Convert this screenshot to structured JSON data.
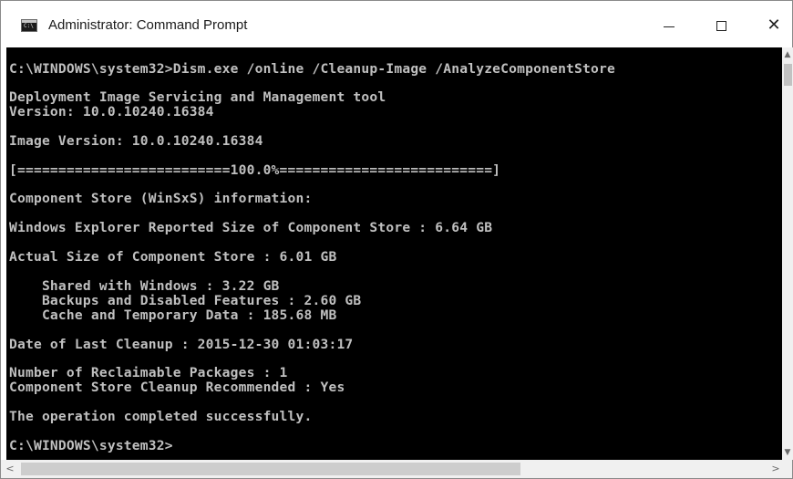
{
  "window": {
    "title": "Administrator: Command Prompt",
    "controls": {
      "minimize": "—",
      "maximize": "",
      "close": "✕"
    }
  },
  "console": {
    "lines": [
      "C:\\WINDOWS\\system32>Dism.exe /online /Cleanup-Image /AnalyzeComponentStore",
      "",
      "Deployment Image Servicing and Management tool",
      "Version: 10.0.10240.16384",
      "",
      "Image Version: 10.0.10240.16384",
      "",
      "[==========================100.0%==========================]",
      "",
      "Component Store (WinSxS) information:",
      "",
      "Windows Explorer Reported Size of Component Store : 6.64 GB",
      "",
      "Actual Size of Component Store : 6.01 GB",
      "",
      "    Shared with Windows : 3.22 GB",
      "    Backups and Disabled Features : 2.60 GB",
      "    Cache and Temporary Data : 185.68 MB",
      "",
      "Date of Last Cleanup : 2015-12-30 01:03:17",
      "",
      "Number of Reclaimable Packages : 1",
      "Component Store Cleanup Recommended : Yes",
      "",
      "The operation completed successfully.",
      "",
      "C:\\WINDOWS\\system32>"
    ]
  },
  "scrollbars": {
    "up_arrow": "▲",
    "down_arrow": "▼",
    "left_arrow": "<",
    "right_arrow": ">"
  },
  "colors": {
    "console_bg": "#000000",
    "console_fg": "#c0c0c0",
    "titlebar_bg": "#ffffff"
  }
}
